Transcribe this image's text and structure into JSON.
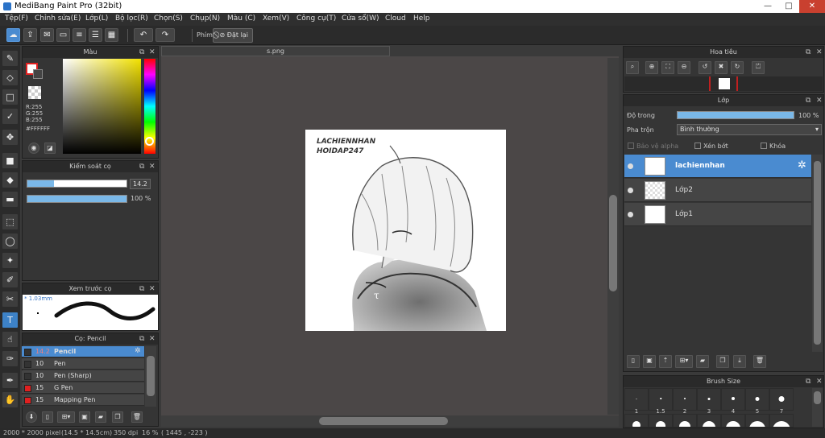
{
  "window": {
    "title": "MediBang Paint Pro (32bit)",
    "minimize": "—",
    "maximize": "□",
    "close": "✕"
  },
  "menu": [
    "Tệp(F)",
    "Chỉnh sửa(E)",
    "Lớp(L)",
    "Bộ lọc(R)",
    "Chọn(S)",
    "Chụp(N)",
    "Màu (C)",
    "Xem(V)",
    "Công cụ(T)",
    "Cửa sổ(W)",
    "Cloud",
    "Help"
  ],
  "toolbar": {
    "hand_label": "Phím",
    "reset_label": "Đặt lại"
  },
  "color_panel": {
    "title": "Màu",
    "r": "R:255",
    "g": "G:255",
    "b": "B:255",
    "hex": "#FFFFFF"
  },
  "brush_control": {
    "title": "Kiểm soát cọ",
    "size": "14.2",
    "size_fraction": 0.27,
    "opacity": "100 %",
    "opacity_fraction": 1.0
  },
  "brush_preview": {
    "title": "Xem trước cọ",
    "size": "1.03mm"
  },
  "brush_list": {
    "title": "Cọ: Pencil",
    "items": [
      {
        "size": "14.2",
        "name": "Pencil",
        "color": "#333333",
        "selected": true
      },
      {
        "size": "10",
        "name": "Pen",
        "color": "#333333",
        "selected": false
      },
      {
        "size": "10",
        "name": "Pen (Sharp)",
        "color": "#333333",
        "selected": false
      },
      {
        "size": "15",
        "name": "G Pen",
        "color": "#e02020",
        "selected": false
      },
      {
        "size": "15",
        "name": "Mapping Pen",
        "color": "#e02020",
        "selected": false
      }
    ]
  },
  "document": {
    "tab": "s.png",
    "watermark_line1": "LACHIENNHAN",
    "watermark_line2": "HOIDAP247"
  },
  "navigator": {
    "title": "Hoa tiêu"
  },
  "layer_panel": {
    "title": "Lớp",
    "opacity_label": "Độ trong",
    "opacity": "100 %",
    "opacity_fraction": 1.0,
    "blend_label": "Pha trộn",
    "blend_mode": "Bình thường",
    "protect_alpha": "Bảo vệ alpha",
    "clipping": "Xén bớt",
    "lock": "Khóa",
    "layers": [
      {
        "name": "lachiennhan",
        "selected": true
      },
      {
        "name": "Lớp2",
        "selected": false
      },
      {
        "name": "Lớp1",
        "selected": false
      }
    ]
  },
  "brush_size": {
    "title": "Brush Size",
    "sizes": [
      "1",
      "1.5",
      "2",
      "3",
      "4",
      "5",
      "7"
    ]
  },
  "status": {
    "dimensions": "2000 * 2000 pixel",
    "physical": "(14.5 * 14.5cm)",
    "dpi": "350 dpi",
    "zoom": "16 %",
    "cursor": "( 1445 , -223 )"
  }
}
